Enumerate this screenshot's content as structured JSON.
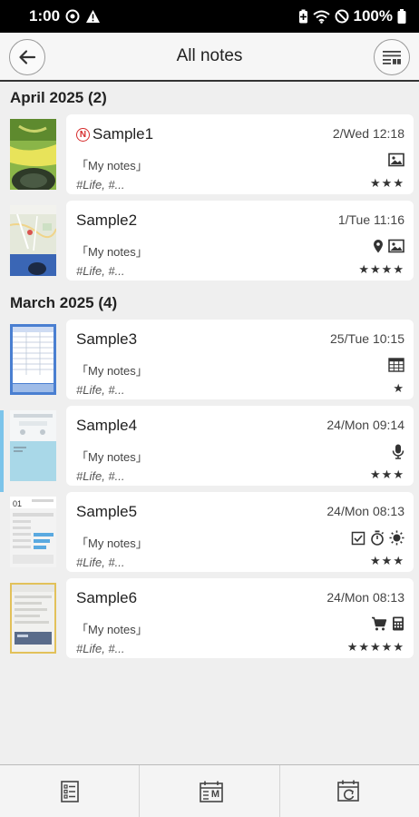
{
  "status_bar": {
    "time": "1:00",
    "battery": "100%"
  },
  "header": {
    "title": "All notes"
  },
  "sections": [
    {
      "label": "April 2025 (2)",
      "notes": [
        {
          "title": "Sample1",
          "is_new": true,
          "new_badge": "N",
          "date": "2/Wed 12:18",
          "folder": "「My notes」",
          "tags": "#Life, #...",
          "stars": "★★★",
          "icons": [
            "image-icon"
          ]
        },
        {
          "title": "Sample2",
          "is_new": false,
          "date": "1/Tue 11:16",
          "folder": "「My notes」",
          "tags": "#Life, #...",
          "stars": "★★★★",
          "icons": [
            "location-icon",
            "image-icon"
          ]
        }
      ]
    },
    {
      "label": "March 2025 (4)",
      "notes": [
        {
          "title": "Sample3",
          "is_new": false,
          "date": "25/Tue 10:15",
          "folder": "「My notes」",
          "tags": "#Life, #...",
          "stars": "★",
          "icons": [
            "table-icon"
          ]
        },
        {
          "title": "Sample4",
          "is_new": false,
          "date": "24/Mon 09:14",
          "folder": "「My notes」",
          "tags": "#Life, #...",
          "stars": "★★★",
          "icons": [
            "microphone-icon"
          ]
        },
        {
          "title": "Sample5",
          "is_new": false,
          "date": "24/Mon 08:13",
          "folder": "「My notes」",
          "tags": "#Life, #...",
          "stars": "★★★",
          "icons": [
            "checkbox-icon",
            "timer-icon",
            "sun-icon"
          ]
        },
        {
          "title": "Sample6",
          "is_new": false,
          "date": "24/Mon 08:13",
          "folder": "「My notes」",
          "tags": "#Life, #...",
          "stars": "★★★★★",
          "icons": [
            "cart-icon",
            "calculator-icon"
          ]
        }
      ]
    }
  ],
  "bottom_bar": {
    "month_icon_label": "M"
  },
  "colors": {
    "accent": "#7cc4ea",
    "new_badge": "#d62b2b",
    "card": "#ffffff",
    "background": "#efefef"
  }
}
